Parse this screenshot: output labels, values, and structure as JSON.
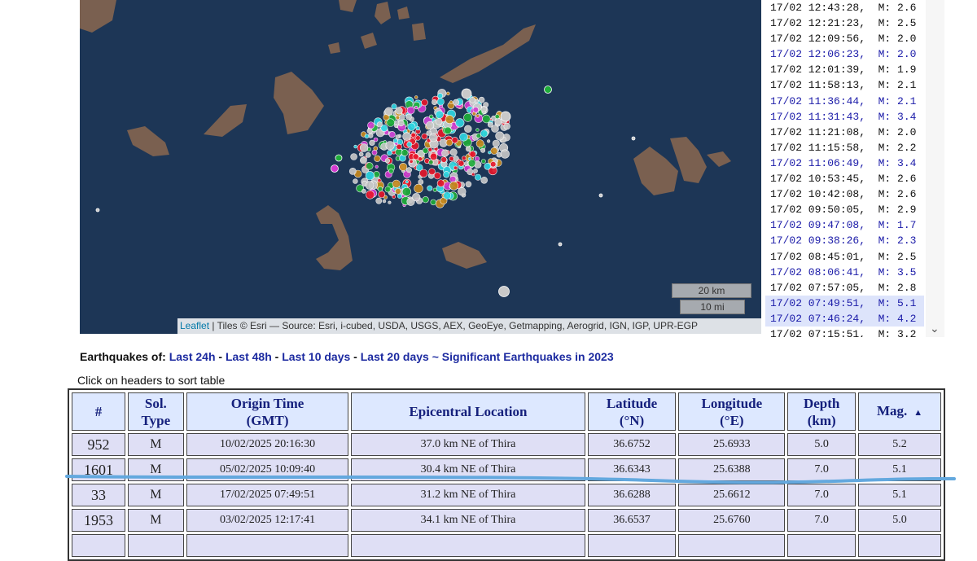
{
  "map": {
    "scale_km": "20 km",
    "scale_mi": "10 mi",
    "attribution_link": "Leaflet",
    "attribution_text": " | Tiles © Esri — Source: Esri, i-cubed, USDA, USGS, AEX, GeoEye, Getmapping, Aerogrid, IGN, IGP, UPR-EGP",
    "colors": {
      "sea": "#1d3656",
      "land": "#7a6050",
      "red": "#e8162a",
      "green": "#1fae3a",
      "cyan": "#2fd8e4",
      "magenta": "#d43ad0",
      "gray": "#c9c9c9",
      "orange": "#c98a1c"
    }
  },
  "quake_list": [
    {
      "text": "17/02 12:43:28,  M: 2.6",
      "color": "black",
      "highlight": false
    },
    {
      "text": "17/02 12:21:23,  M: 2.5",
      "color": "black",
      "highlight": false
    },
    {
      "text": "17/02 12:09:56,  M: 2.0",
      "color": "black",
      "highlight": false
    },
    {
      "text": "17/02 12:06:23,  M: 2.0",
      "color": "blue",
      "highlight": false
    },
    {
      "text": "17/02 12:01:39,  M: 1.9",
      "color": "black",
      "highlight": false
    },
    {
      "text": "17/02 11:58:13,  M: 2.1",
      "color": "black",
      "highlight": false
    },
    {
      "text": "17/02 11:36:44,  M: 2.1",
      "color": "blue",
      "highlight": false
    },
    {
      "text": "17/02 11:31:43,  M: 3.4",
      "color": "blue",
      "highlight": false
    },
    {
      "text": "17/02 11:21:08,  M: 2.0",
      "color": "black",
      "highlight": false
    },
    {
      "text": "17/02 11:15:58,  M: 2.2",
      "color": "black",
      "highlight": false
    },
    {
      "text": "17/02 11:06:49,  M: 3.4",
      "color": "blue",
      "highlight": false
    },
    {
      "text": "17/02 10:53:45,  M: 2.6",
      "color": "black",
      "highlight": false
    },
    {
      "text": "17/02 10:42:08,  M: 2.6",
      "color": "black",
      "highlight": false
    },
    {
      "text": "17/02 09:50:05,  M: 2.9",
      "color": "black",
      "highlight": false
    },
    {
      "text": "17/02 09:47:08,  M: 1.7",
      "color": "blue",
      "highlight": false
    },
    {
      "text": "17/02 09:38:26,  M: 2.3",
      "color": "blue",
      "highlight": false
    },
    {
      "text": "17/02 08:45:01,  M: 2.5",
      "color": "black",
      "highlight": false
    },
    {
      "text": "17/02 08:06:41,  M: 3.5",
      "color": "blue",
      "highlight": false
    },
    {
      "text": "17/02 07:57:05,  M: 2.8",
      "color": "black",
      "highlight": false
    },
    {
      "text": "17/02 07:49:51,  M: 5.1",
      "color": "blue",
      "highlight": true
    },
    {
      "text": "17/02 07:46:24,  M: 4.2",
      "color": "blue",
      "highlight": true
    },
    {
      "text": "17/02 07:15:51,  M: 3.2",
      "color": "black",
      "highlight": false
    }
  ],
  "filters": {
    "prefix": "Earthquakes of: ",
    "links": [
      "Last 24h",
      "Last 48h",
      "Last 10 days",
      "Last 20 days"
    ],
    "separator": " - ",
    "tilde": " ~ ",
    "significant": "Significant Earthquakes in 2023"
  },
  "hint": "Click on headers to sort table",
  "table": {
    "headers": [
      {
        "line1": "#",
        "line2": ""
      },
      {
        "line1": "Sol.",
        "line2": "Type"
      },
      {
        "line1": "Origin Time",
        "line2": "(GMT)"
      },
      {
        "line1": "Epicentral Location",
        "line2": ""
      },
      {
        "line1": "Latitude",
        "line2": "(°N)"
      },
      {
        "line1": "Longitude",
        "line2": "(°E)"
      },
      {
        "line1": "Depth",
        "line2": "(km)"
      },
      {
        "line1": "Mag.",
        "line2": ""
      }
    ],
    "sort_indicator": "▲",
    "rows": [
      [
        "952",
        "M",
        "10/02/2025 20:16:30",
        "37.0 km NE of Thira",
        "36.6752",
        "25.6933",
        "5.0",
        "5.2"
      ],
      [
        "1601",
        "M",
        "05/02/2025 10:09:40",
        "30.4 km NE of Thira",
        "36.6343",
        "25.6388",
        "7.0",
        "5.1"
      ],
      [
        "33",
        "M",
        "17/02/2025 07:49:51",
        "31.2 km NE of Thira",
        "36.6288",
        "25.6612",
        "7.0",
        "5.1"
      ],
      [
        "1953",
        "M",
        "03/02/2025 12:17:41",
        "34.1 km NE of Thira",
        "36.6537",
        "25.6760",
        "7.0",
        "5.0"
      ],
      [
        "",
        "",
        "",
        "",
        "",
        "",
        "",
        ""
      ]
    ]
  }
}
